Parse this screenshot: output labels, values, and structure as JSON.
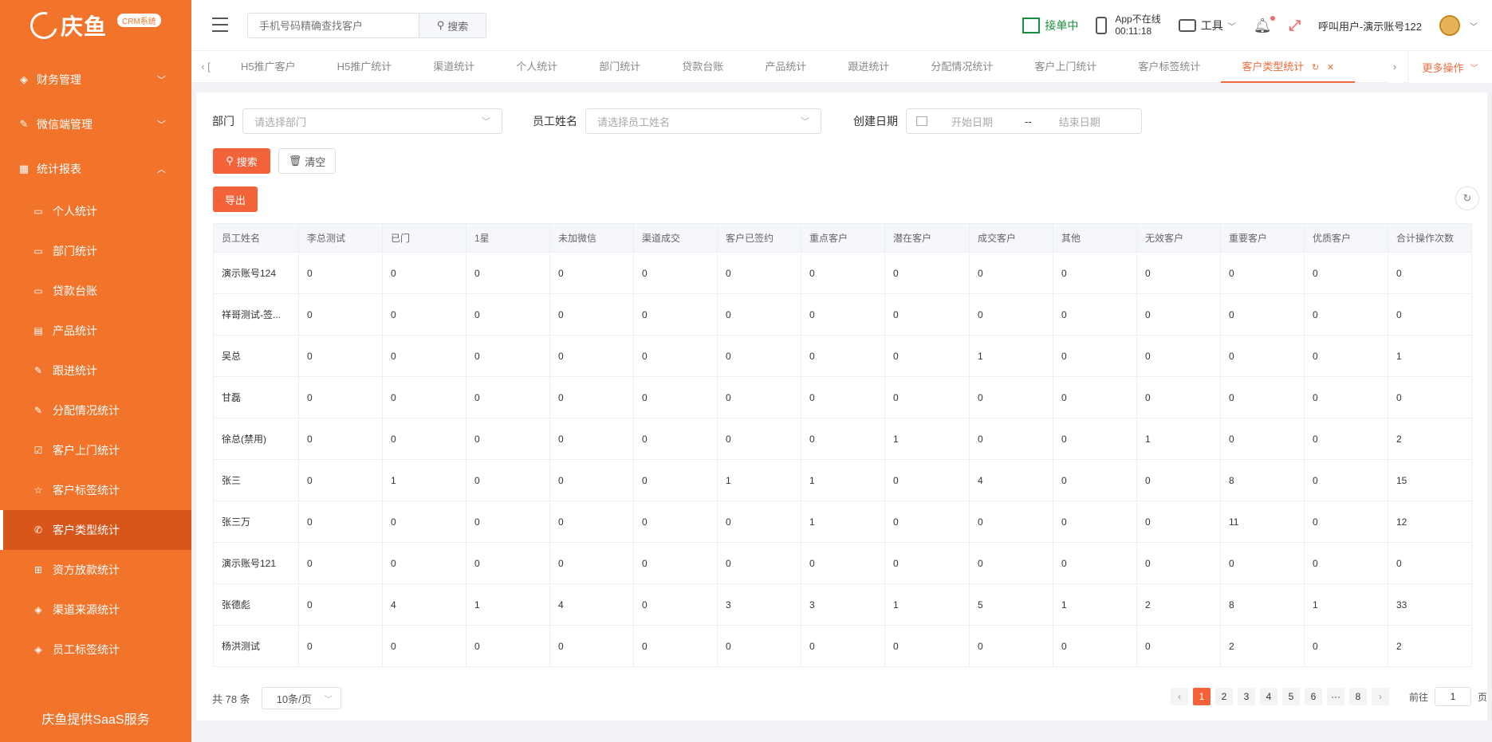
{
  "logo": {
    "text": "庆鱼",
    "badge": "CRM系统"
  },
  "sidebar": {
    "groups": [
      {
        "label": "财务管理",
        "icon": "diamond-icon",
        "arrow": "﹀"
      },
      {
        "label": "微信端管理",
        "icon": "edit-icon",
        "arrow": "﹀"
      },
      {
        "label": "统计报表",
        "icon": "grid-icon",
        "arrow": "︿"
      }
    ],
    "items": [
      {
        "label": "个人统计",
        "icon": "monitor-icon"
      },
      {
        "label": "部门统计",
        "icon": "monitor-icon"
      },
      {
        "label": "贷款台账",
        "icon": "monitor-icon"
      },
      {
        "label": "产品统计",
        "icon": "document-icon"
      },
      {
        "label": "跟进统计",
        "icon": "edit-icon"
      },
      {
        "label": "分配情况统计",
        "icon": "edit-icon"
      },
      {
        "label": "客户上门统计",
        "icon": "checkbox-icon"
      },
      {
        "label": "客户标签统计",
        "icon": "star-icon"
      },
      {
        "label": "客户类型统计",
        "icon": "phone-icon"
      },
      {
        "label": "资方放款统计",
        "icon": "apps-icon"
      },
      {
        "label": "渠道来源统计",
        "icon": "diamond-icon"
      },
      {
        "label": "员工标签统计",
        "icon": "diamond-icon"
      }
    ],
    "footer": "庆鱼提供SaaS服务"
  },
  "header": {
    "search_placeholder": "手机号码精确查找客户",
    "search_label": "搜索",
    "accept_label": "接单中",
    "app_status_line1": "App不在线",
    "app_status_line2": "00:11:18",
    "tools_label": "工具",
    "user_label": "呼叫用户-演示账号122"
  },
  "tabs": {
    "partial_first": "[",
    "items": [
      "H5推广客户",
      "H5推广统计",
      "渠道统计",
      "个人统计",
      "部门统计",
      "贷款台账",
      "产品统计",
      "跟进统计",
      "分配情况统计",
      "客户上门统计",
      "客户标签统计",
      "客户类型统计"
    ],
    "active_index": 11,
    "more_label": "更多操作"
  },
  "filters": {
    "dept_label": "部门",
    "dept_placeholder": "请选择部门",
    "staff_label": "员工姓名",
    "staff_placeholder": "请选择员工姓名",
    "date_label": "创建日期",
    "start_placeholder": "开始日期",
    "range_sep": "--",
    "end_placeholder": "结束日期",
    "search_button": "搜索",
    "clear_button": "清空",
    "export_button": "导出"
  },
  "table": {
    "columns": [
      "员工姓名",
      "李总测试",
      "已门",
      "1星",
      "未加微信",
      "渠道成交",
      "客户已签约",
      "重点客户",
      "潜在客户",
      "成交客户",
      "其他",
      "无效客户",
      "重要客户",
      "优质客户",
      "合计操作次数"
    ],
    "rows": [
      [
        "演示账号124",
        "0",
        "0",
        "0",
        "0",
        "0",
        "0",
        "0",
        "0",
        "0",
        "0",
        "0",
        "0",
        "0",
        "0"
      ],
      [
        "祥哥测试-签...",
        "0",
        "0",
        "0",
        "0",
        "0",
        "0",
        "0",
        "0",
        "0",
        "0",
        "0",
        "0",
        "0",
        "0"
      ],
      [
        "吴总",
        "0",
        "0",
        "0",
        "0",
        "0",
        "0",
        "0",
        "0",
        "1",
        "0",
        "0",
        "0",
        "0",
        "1"
      ],
      [
        "甘磊",
        "0",
        "0",
        "0",
        "0",
        "0",
        "0",
        "0",
        "0",
        "0",
        "0",
        "0",
        "0",
        "0",
        "0"
      ],
      [
        "徐总(禁用)",
        "0",
        "0",
        "0",
        "0",
        "0",
        "0",
        "0",
        "1",
        "0",
        "0",
        "1",
        "0",
        "0",
        "2"
      ],
      [
        "张三",
        "0",
        "1",
        "0",
        "0",
        "0",
        "1",
        "1",
        "0",
        "4",
        "0",
        "0",
        "8",
        "0",
        "15"
      ],
      [
        "张三万",
        "0",
        "0",
        "0",
        "0",
        "0",
        "0",
        "1",
        "0",
        "0",
        "0",
        "0",
        "11",
        "0",
        "12"
      ],
      [
        "演示账号121",
        "0",
        "0",
        "0",
        "0",
        "0",
        "0",
        "0",
        "0",
        "0",
        "0",
        "0",
        "0",
        "0",
        "0"
      ],
      [
        "张德彪",
        "0",
        "4",
        "1",
        "4",
        "0",
        "3",
        "3",
        "1",
        "5",
        "1",
        "2",
        "8",
        "1",
        "33"
      ],
      [
        "杨洪测试",
        "0",
        "0",
        "0",
        "0",
        "0",
        "0",
        "0",
        "0",
        "0",
        "0",
        "0",
        "2",
        "0",
        "2"
      ]
    ]
  },
  "pagination": {
    "total_text": "共 78 条",
    "page_size": "10条/页",
    "pages": [
      "1",
      "2",
      "3",
      "4",
      "5",
      "6",
      "···",
      "8"
    ],
    "current": "1",
    "goto_label": "前往",
    "goto_value": "1",
    "page_suffix": "页"
  }
}
